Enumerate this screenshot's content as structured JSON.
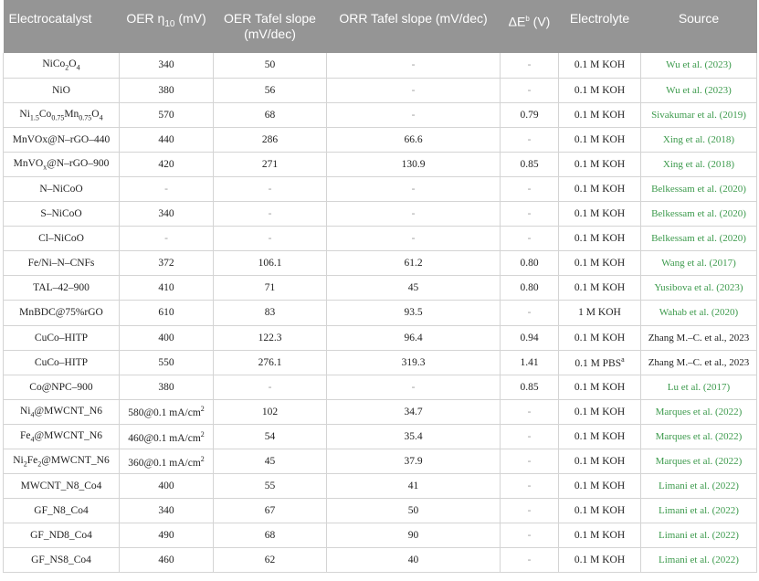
{
  "table": {
    "headers": [
      {
        "text": "Electrocatalyst"
      },
      {
        "text": "OER η",
        "sub": "10",
        "after": " (mV)"
      },
      {
        "text": "OER Tafel slope (mV/dec)"
      },
      {
        "text": "ORR Tafel slope (mV/dec)"
      },
      {
        "text": "ΔE",
        "sup": "b",
        "after": " (V)"
      },
      {
        "text": "Electrolyte"
      },
      {
        "text": "Source"
      }
    ],
    "rows": [
      {
        "cat": [
          [
            "NiCo",
            ""
          ],
          [
            "2",
            "sub"
          ],
          [
            "O",
            ""
          ],
          [
            "4",
            "sub"
          ]
        ],
        "eta": "340",
        "oer": "50",
        "orr": "-",
        "de": "-",
        "elec": [
          [
            "0.1 M KOH",
            ""
          ]
        ],
        "src": "Wu et al. (2023)",
        "src_dark": false
      },
      {
        "cat": [
          [
            "NiO",
            ""
          ]
        ],
        "eta": "380",
        "oer": "56",
        "orr": "-",
        "de": "-",
        "elec": [
          [
            "0.1 M KOH",
            ""
          ]
        ],
        "src": "Wu et al. (2023)",
        "src_dark": false
      },
      {
        "cat": [
          [
            "Ni",
            ""
          ],
          [
            "1.5",
            "sub"
          ],
          [
            "Co",
            ""
          ],
          [
            "0.75",
            "sub"
          ],
          [
            "Mn",
            ""
          ],
          [
            "0.75",
            "sub"
          ],
          [
            "O",
            ""
          ],
          [
            "4",
            "sub"
          ]
        ],
        "eta": "570",
        "oer": "68",
        "orr": "-",
        "de": "0.79",
        "elec": [
          [
            "0.1 M KOH",
            ""
          ]
        ],
        "src": "Sivakumar et al. (2019)",
        "src_dark": false
      },
      {
        "cat": [
          [
            "MnVOx@N–rGO–440",
            ""
          ]
        ],
        "eta": "440",
        "oer": "286",
        "orr": "66.6",
        "de": "-",
        "elec": [
          [
            "0.1 M KOH",
            ""
          ]
        ],
        "src": "Xing et al. (2018)",
        "src_dark": false
      },
      {
        "cat": [
          [
            "MnVO",
            ""
          ],
          [
            "x",
            "sub"
          ],
          [
            "@N–rGO–900",
            ""
          ]
        ],
        "eta": "420",
        "oer": "271",
        "orr": "130.9",
        "de": "0.85",
        "elec": [
          [
            "0.1 M KOH",
            ""
          ]
        ],
        "src": "Xing et al. (2018)",
        "src_dark": false
      },
      {
        "cat": [
          [
            "N–NiCoO",
            ""
          ]
        ],
        "eta": "-",
        "oer": "-",
        "orr": "-",
        "de": "-",
        "elec": [
          [
            "0.1 M KOH",
            ""
          ]
        ],
        "src": "Belkessam et al. (2020)",
        "src_dark": false
      },
      {
        "cat": [
          [
            "S–NiCoO",
            ""
          ]
        ],
        "eta": "340",
        "oer": "-",
        "orr": "-",
        "de": "-",
        "elec": [
          [
            "0.1 M KOH",
            ""
          ]
        ],
        "src": "Belkessam et al. (2020)",
        "src_dark": false
      },
      {
        "cat": [
          [
            "Cl–NiCoO",
            ""
          ]
        ],
        "eta": "-",
        "oer": "-",
        "orr": "-",
        "de": "-",
        "elec": [
          [
            "0.1 M KOH",
            ""
          ]
        ],
        "src": "Belkessam et al. (2020)",
        "src_dark": false
      },
      {
        "cat": [
          [
            "Fe/Ni–N–CNFs",
            ""
          ]
        ],
        "eta": "372",
        "oer": "106.1",
        "orr": "61.2",
        "de": "0.80",
        "elec": [
          [
            "0.1 M KOH",
            ""
          ]
        ],
        "src": "Wang et al. (2017)",
        "src_dark": false
      },
      {
        "cat": [
          [
            "TAL–42–900",
            ""
          ]
        ],
        "eta": "410",
        "oer": "71",
        "orr": "45",
        "de": "0.80",
        "elec": [
          [
            "0.1 M KOH",
            ""
          ]
        ],
        "src": "Yusibova et al. (2023)",
        "src_dark": false
      },
      {
        "cat": [
          [
            "MnBDC@75%rGO",
            ""
          ]
        ],
        "eta": "610",
        "oer": "83",
        "orr": "93.5",
        "de": "-",
        "elec": [
          [
            "1 M KOH",
            ""
          ]
        ],
        "src": "Wahab et al. (2020)",
        "src_dark": false
      },
      {
        "cat": [
          [
            "CuCo–HITP",
            ""
          ]
        ],
        "eta": "400",
        "oer": "122.3",
        "orr": "96.4",
        "de": "0.94",
        "elec": [
          [
            "0.1 M KOH",
            ""
          ]
        ],
        "src": "Zhang M.–C. et al., 2023",
        "src_dark": true
      },
      {
        "cat": [
          [
            "CuCo–HITP",
            ""
          ]
        ],
        "eta": "550",
        "oer": "276.1",
        "orr": "319.3",
        "de": "1.41",
        "elec": [
          [
            "0.1 M PBS",
            ""
          ],
          [
            "a",
            "sup"
          ]
        ],
        "src": "Zhang M.–C. et al., 2023",
        "src_dark": true
      },
      {
        "cat": [
          [
            "Co@NPC–900",
            ""
          ]
        ],
        "eta": "380",
        "oer": "-",
        "orr": "-",
        "de": "0.85",
        "elec": [
          [
            "0.1 M KOH",
            ""
          ]
        ],
        "src": "Lu et al. (2017)",
        "src_dark": false
      },
      {
        "cat": [
          [
            "Ni",
            ""
          ],
          [
            "4",
            "sub"
          ],
          [
            "@MWCNT_N6",
            ""
          ]
        ],
        "eta": [
          [
            "580@0.1 mA/cm",
            ""
          ],
          [
            "2",
            "sup"
          ]
        ],
        "oer": "102",
        "orr": "34.7",
        "de": "-",
        "elec": [
          [
            "0.1 M KOH",
            ""
          ]
        ],
        "src": "Marques et al. (2022)",
        "src_dark": false
      },
      {
        "cat": [
          [
            "Fe",
            ""
          ],
          [
            "4",
            "sub"
          ],
          [
            "@MWCNT_N6",
            ""
          ]
        ],
        "eta": [
          [
            "460@0.1 mA/cm",
            ""
          ],
          [
            "2",
            "sup"
          ]
        ],
        "oer": "54",
        "orr": "35.4",
        "de": "-",
        "elec": [
          [
            "0.1 M KOH",
            ""
          ]
        ],
        "src": "Marques et al. (2022)",
        "src_dark": false
      },
      {
        "cat": [
          [
            "Ni",
            ""
          ],
          [
            "2",
            "sub"
          ],
          [
            "Fe",
            ""
          ],
          [
            "2",
            "sub"
          ],
          [
            "@MWCNT_N6",
            ""
          ]
        ],
        "eta": [
          [
            "360@0.1 mA/cm",
            ""
          ],
          [
            "2",
            "sup"
          ]
        ],
        "oer": "45",
        "orr": "37.9",
        "de": "-",
        "elec": [
          [
            "0.1 M KOH",
            ""
          ]
        ],
        "src": "Marques et al. (2022)",
        "src_dark": false
      },
      {
        "cat": [
          [
            "MWCNT_N8_Co4",
            ""
          ]
        ],
        "eta": "400",
        "oer": "55",
        "orr": "41",
        "de": "-",
        "elec": [
          [
            "0.1 M KOH",
            ""
          ]
        ],
        "src": "Limani et al. (2022)",
        "src_dark": false
      },
      {
        "cat": [
          [
            "GF_N8_Co4",
            ""
          ]
        ],
        "eta": "340",
        "oer": "67",
        "orr": "50",
        "de": "-",
        "elec": [
          [
            "0.1 M KOH",
            ""
          ]
        ],
        "src": "Limani et al. (2022)",
        "src_dark": false
      },
      {
        "cat": [
          [
            "GF_ND8_Co4",
            ""
          ]
        ],
        "eta": "490",
        "oer": "68",
        "orr": "90",
        "de": "-",
        "elec": [
          [
            "0.1 M KOH",
            ""
          ]
        ],
        "src": "Limani et al. (2022)",
        "src_dark": false
      },
      {
        "cat": [
          [
            "GF_NS8_Co4",
            ""
          ]
        ],
        "eta": "460",
        "oer": "62",
        "orr": "40",
        "de": "-",
        "elec": [
          [
            "0.1 M KOH",
            ""
          ]
        ],
        "src": "Limani et al. (2022)",
        "src_dark": false
      }
    ]
  }
}
